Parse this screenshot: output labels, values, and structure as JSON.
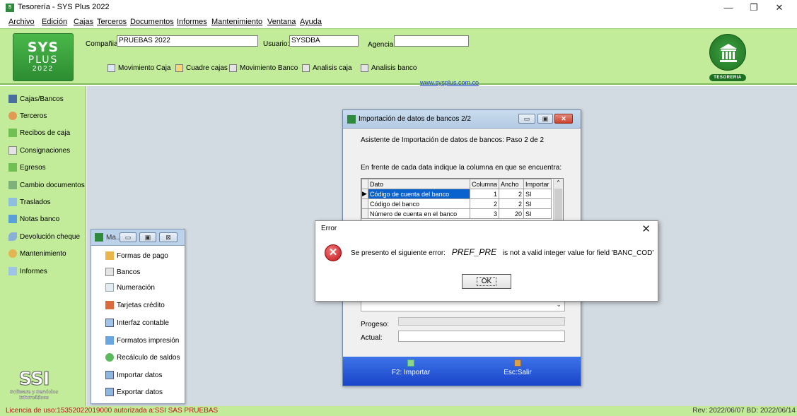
{
  "window": {
    "title": "Tesorería - SYS Plus 2022",
    "controls": [
      "—",
      "❐",
      "✕"
    ]
  },
  "menu": [
    "Archivo",
    "Edición",
    "Cajas",
    "Terceros",
    "Documentos",
    "Informes",
    "Mantenimiento",
    "Ventana",
    "Ayuda"
  ],
  "header": {
    "logo": [
      "SYS",
      "PLUS",
      "2022"
    ],
    "company_label": "Compañia:",
    "company_value": "PRUEBAS 2022",
    "user_label": "Usuario:",
    "user_value": "SYSDBA",
    "agency_label": "Agencia:",
    "agency_value": "",
    "toolbar": [
      "Movimiento Caja",
      "Cuadre cajas",
      "Movimiento Banco",
      "Analisis caja",
      "Analisis banco"
    ],
    "website": "www.sysplus.com.co",
    "tesoreria_badge": "TESORERIA"
  },
  "sidebar": {
    "items": [
      "Cajas/Bancos",
      "Terceros",
      "Recibos de caja",
      "Consignaciones",
      "Egresos",
      "Cambio documentos",
      "Traslados",
      "Notas banco",
      "Devolución cheque",
      "Mantenimiento",
      "Informes"
    ],
    "ssi_mark": "SSI",
    "ssi_text": "Software y Servicios Informáticos"
  },
  "small_window": {
    "title": "Ma...",
    "items": [
      "Formas de pago",
      "Bancos",
      "Numeración",
      "Tarjetas crédito",
      "Interfaz contable",
      "Formatos impresión",
      "Recálculo de saldos",
      "Importar datos",
      "Exportar datos"
    ]
  },
  "import_dialog": {
    "title": "Importación de datos de bancos 2/2",
    "subtitle": "Asistente de Importación de datos de bancos: Paso 2 de 2",
    "instruction": "En frente de cada data indique la columna en que se encuentra:",
    "columns": [
      "Dato",
      "Columna",
      "Ancho",
      "Importar"
    ],
    "rows": [
      {
        "dato": "Código de cuenta del banco",
        "columna": "1",
        "ancho": "2",
        "importar": "SI"
      },
      {
        "dato": "Código del banco",
        "columna": "2",
        "ancho": "2",
        "importar": "SI"
      },
      {
        "dato": "Número de cuenta en el banco",
        "columna": "3",
        "ancho": "20",
        "importar": "SI"
      }
    ],
    "progress_label": "Progeso:",
    "progress": 0,
    "actual_label": "Actual:",
    "actual_value": "",
    "import_button": "F2: Importar",
    "exit_button": "Esc:Salir"
  },
  "error_dialog": {
    "title": "Error",
    "message_prefix": "Se presento el siguiente error:",
    "message_code": "PREF_PRE",
    "message_suffix": "is not a valid integer value for field 'BANC_COD'",
    "ok_label": "OK"
  },
  "status": {
    "license": "Licencia de uso:15352022019000 autorizada a:SSI SAS PRUEBAS",
    "revision": "Rev: 2022/06/07 BD: 2022/06/14"
  },
  "colors": {
    "green_band": "#c2ec9a",
    "desktop": "#d3dbe2",
    "selection": "#0a62cf",
    "license_text": "#c0141a"
  }
}
